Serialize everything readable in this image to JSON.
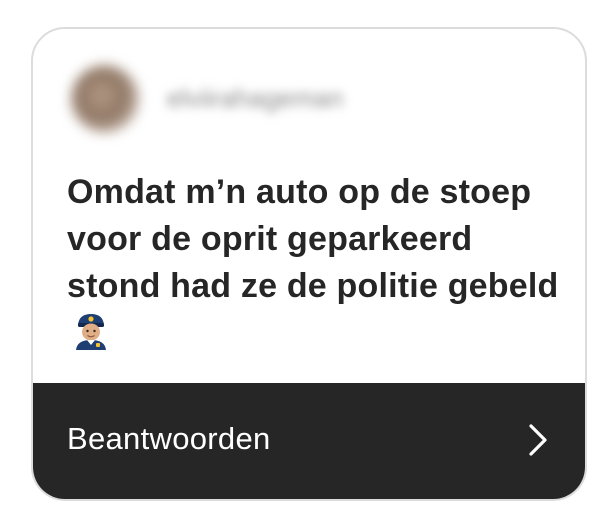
{
  "header": {
    "username": "elviirahageman",
    "avatar_icon": "profile-photo"
  },
  "message": {
    "text": "Omdat m’n auto op de stoep voor de oprit geparkeerd stond had ze de politie gebeld",
    "emoji_icon": "police-officer-emoji"
  },
  "footer": {
    "reply_label": "Beantwoorden",
    "chevron_icon": "chevron-right-icon"
  },
  "colors": {
    "footer_background": "#262626",
    "text": "#262626",
    "card_border": "#dcdcdc"
  }
}
